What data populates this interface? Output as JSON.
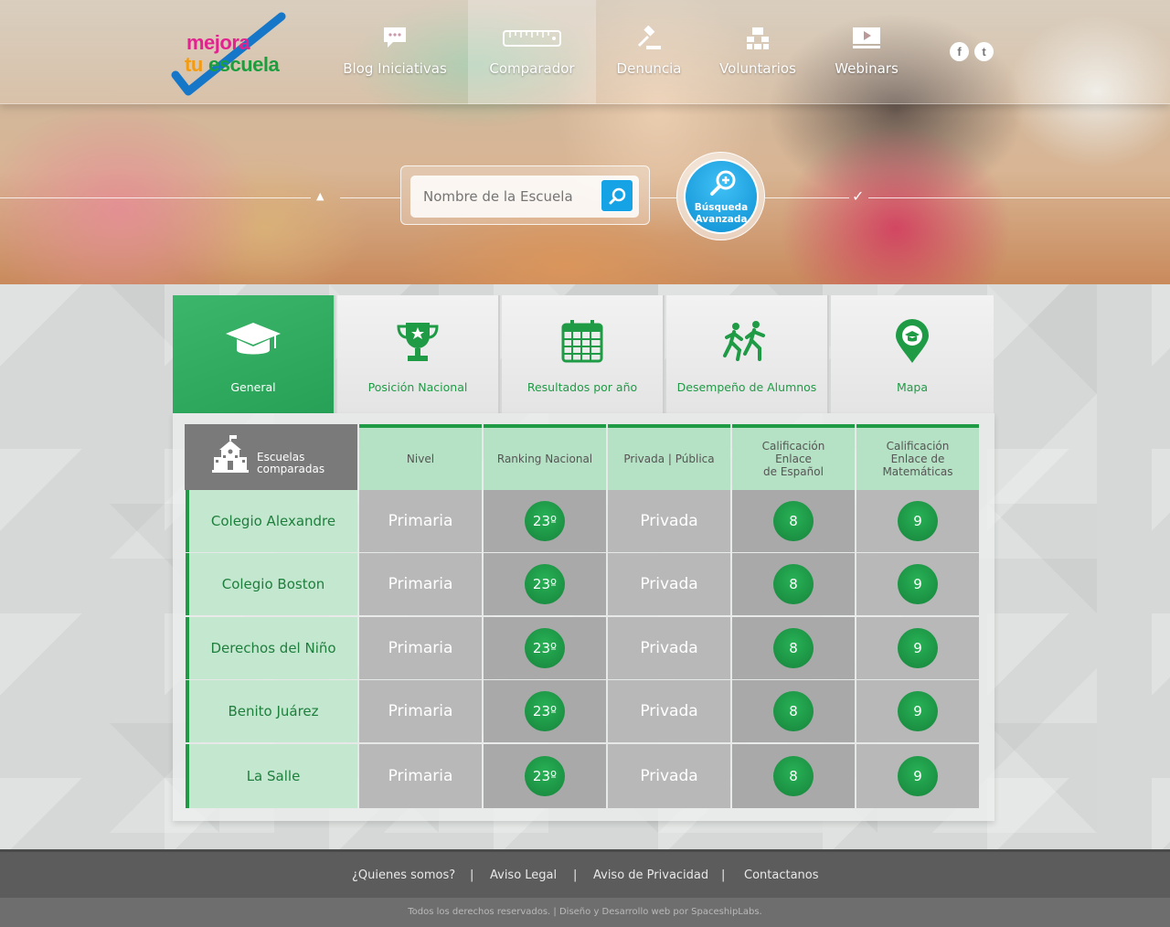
{
  "brand": {
    "line1": "mejora",
    "line2a": "tu",
    "line2b": "escuela"
  },
  "nav": [
    {
      "label": "Blog Iniciativas",
      "icon": "chat-bubble-icon"
    },
    {
      "label": "Comparador",
      "icon": "ruler-icon"
    },
    {
      "label": "Denuncia",
      "icon": "gavel-icon"
    },
    {
      "label": "Voluntarios",
      "icon": "group-icon"
    },
    {
      "label": "Webinars",
      "icon": "video-icon"
    }
  ],
  "social": {
    "facebook": "f",
    "twitter": "t"
  },
  "search": {
    "placeholder": "Nombre de la Escuela",
    "advanced_label_1": "Búsqueda",
    "advanced_label_2": "Avanzada"
  },
  "tabs": [
    {
      "label": "General",
      "icon": "graduation-cap-icon"
    },
    {
      "label": "Posición Nacional",
      "icon": "trophy-icon"
    },
    {
      "label": "Resultados por año",
      "icon": "calendar-icon"
    },
    {
      "label": "Desempeño de Alumnos",
      "icon": "running-people-icon"
    },
    {
      "label": "Mapa",
      "icon": "map-pin-icon"
    }
  ],
  "table": {
    "corner_label_1": "Escuelas",
    "corner_label_2": "comparadas",
    "columns": [
      "Nivel",
      "Ranking Nacional",
      "Privada | Pública",
      "Calificación\nEnlace\nde Español",
      "Calificación\nEnlace de\nMatemáticas"
    ],
    "rows": [
      {
        "name": "Colegio Alexandre",
        "nivel": "Primaria",
        "ranking": "23º",
        "tipo": "Privada",
        "espanol": "8",
        "matematicas": "9"
      },
      {
        "name": "Colegio Boston",
        "nivel": "Primaria",
        "ranking": "23º",
        "tipo": "Privada",
        "espanol": "8",
        "matematicas": "9"
      },
      {
        "name": "Derechos del Niño",
        "nivel": "Primaria",
        "ranking": "23º",
        "tipo": "Privada",
        "espanol": "8",
        "matematicas": "9"
      },
      {
        "name": "Benito Juárez",
        "nivel": "Primaria",
        "ranking": "23º",
        "tipo": "Privada",
        "espanol": "8",
        "matematicas": "9"
      },
      {
        "name": "La Salle",
        "nivel": "Primaria",
        "ranking": "23º",
        "tipo": "Privada",
        "espanol": "8",
        "matematicas": "9"
      }
    ]
  },
  "footer": {
    "links": [
      "¿Quienes somos?",
      "Aviso Legal",
      "Aviso de Privacidad",
      "Contactanos"
    ],
    "separator": "|",
    "copyright": "Todos los derechos reservados. | Diseño y Desarrollo web por SpaceshipLabs."
  },
  "colors": {
    "accent": "#1f9b46",
    "blue": "#15a3e6",
    "gray_header": "#7a7a7a",
    "footer": "#5c5c5c"
  }
}
